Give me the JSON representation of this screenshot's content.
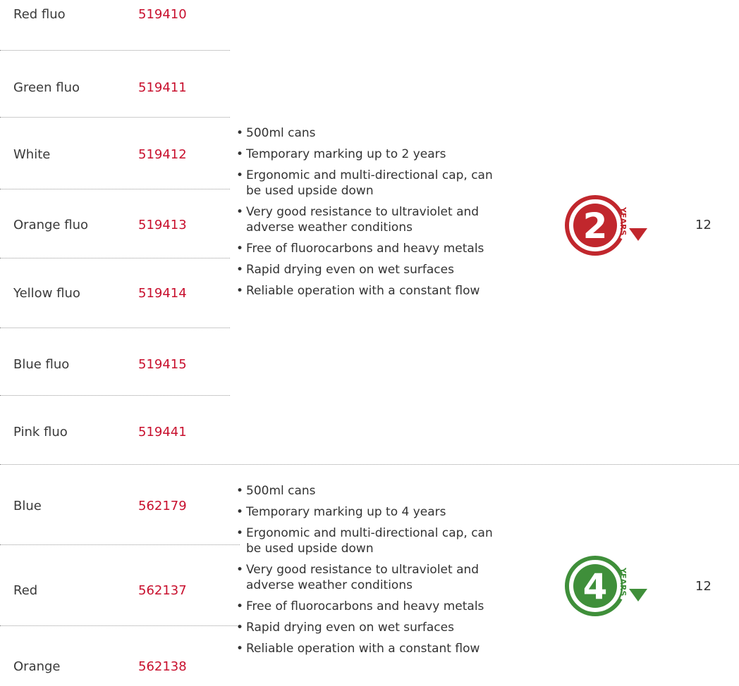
{
  "colors": {
    "ref": "#c8102e",
    "badge2": "#c1272d",
    "badge4": "#3f8f3a"
  },
  "group1": {
    "rows": [
      {
        "name": "Red fluo",
        "ref": "519410"
      },
      {
        "name": "Green fluo",
        "ref": "519411"
      },
      {
        "name": "White",
        "ref": "519412"
      },
      {
        "name": "Orange fluo",
        "ref": "519413"
      },
      {
        "name": "Yellow fluo",
        "ref": "519414"
      },
      {
        "name": "Blue fluo",
        "ref": "519415"
      },
      {
        "name": "Pink fluo",
        "ref": "519441"
      }
    ],
    "features": [
      "500ml cans",
      "Temporary marking up to 2 years",
      "Ergonomic and multi-directional cap, can be used upside down",
      "Very good resistance to ultraviolet and adverse weather conditions",
      "Free of fluorocarbons and heavy metals",
      "Rapid drying even on wet surfaces",
      "Reliable operation with a constant flow"
    ],
    "badge_number": "2",
    "badge_word": "YEARS",
    "quantity": "12"
  },
  "group2": {
    "rows": [
      {
        "name": "Blue",
        "ref": "562179"
      },
      {
        "name": "Red",
        "ref": "562137"
      },
      {
        "name": "Orange",
        "ref": "562138"
      }
    ],
    "features": [
      "500ml cans",
      "Temporary marking up to 4 years",
      "Ergonomic and multi-directional cap, can be used upside down",
      "Very good resistance to ultraviolet and adverse weather conditions",
      "Free of fluorocarbons and heavy metals",
      "Rapid drying even on wet surfaces",
      "Reliable operation with a constant flow"
    ],
    "badge_number": "4",
    "badge_word": "YEARS",
    "quantity": "12"
  },
  "bullet": "•"
}
